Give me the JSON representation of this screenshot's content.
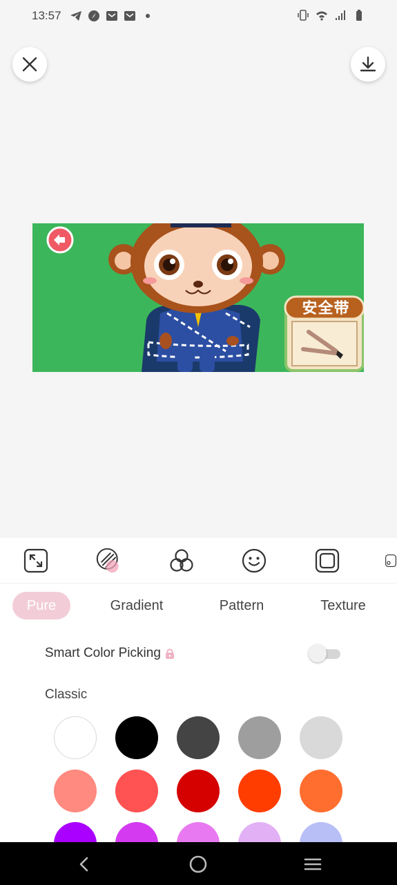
{
  "status_bar": {
    "time": "13:57",
    "left_icons": [
      "telegram-icon",
      "compass-icon",
      "mail-icon",
      "mail-icon",
      "dot-icon"
    ],
    "right_icons": [
      "vibrate-icon",
      "wifi-icon",
      "signal-icon",
      "battery-icon"
    ]
  },
  "top_actions": {
    "close": "close-icon",
    "download": "download-icon"
  },
  "canvas": {
    "background_color": "#3cb65a",
    "sign_text": "安全带"
  },
  "toolbar": {
    "tools": [
      "resize-icon",
      "background-icon",
      "adjust-icon",
      "sticker-icon",
      "frame-icon",
      "more-icon"
    ]
  },
  "tabs": [
    {
      "label": "Pure",
      "active": true
    },
    {
      "label": "Gradient",
      "active": false
    },
    {
      "label": "Pattern",
      "active": false
    },
    {
      "label": "Texture",
      "active": false
    }
  ],
  "smart_color": {
    "label": "Smart Color Picking",
    "locked": true,
    "enabled": false
  },
  "classic": {
    "label": "Classic",
    "colors": [
      "#ffffff",
      "#000000",
      "#444444",
      "#9e9e9e",
      "#d9d9d9",
      "#ff8a80",
      "#ff5252",
      "#d50000",
      "#ff3d00",
      "#ff6d2f",
      "#aa00ff",
      "#d43af0",
      "#e879f0",
      "#e2b0f5",
      "#b8bff7"
    ]
  },
  "nav": [
    "back-icon",
    "home-icon",
    "recents-icon"
  ]
}
